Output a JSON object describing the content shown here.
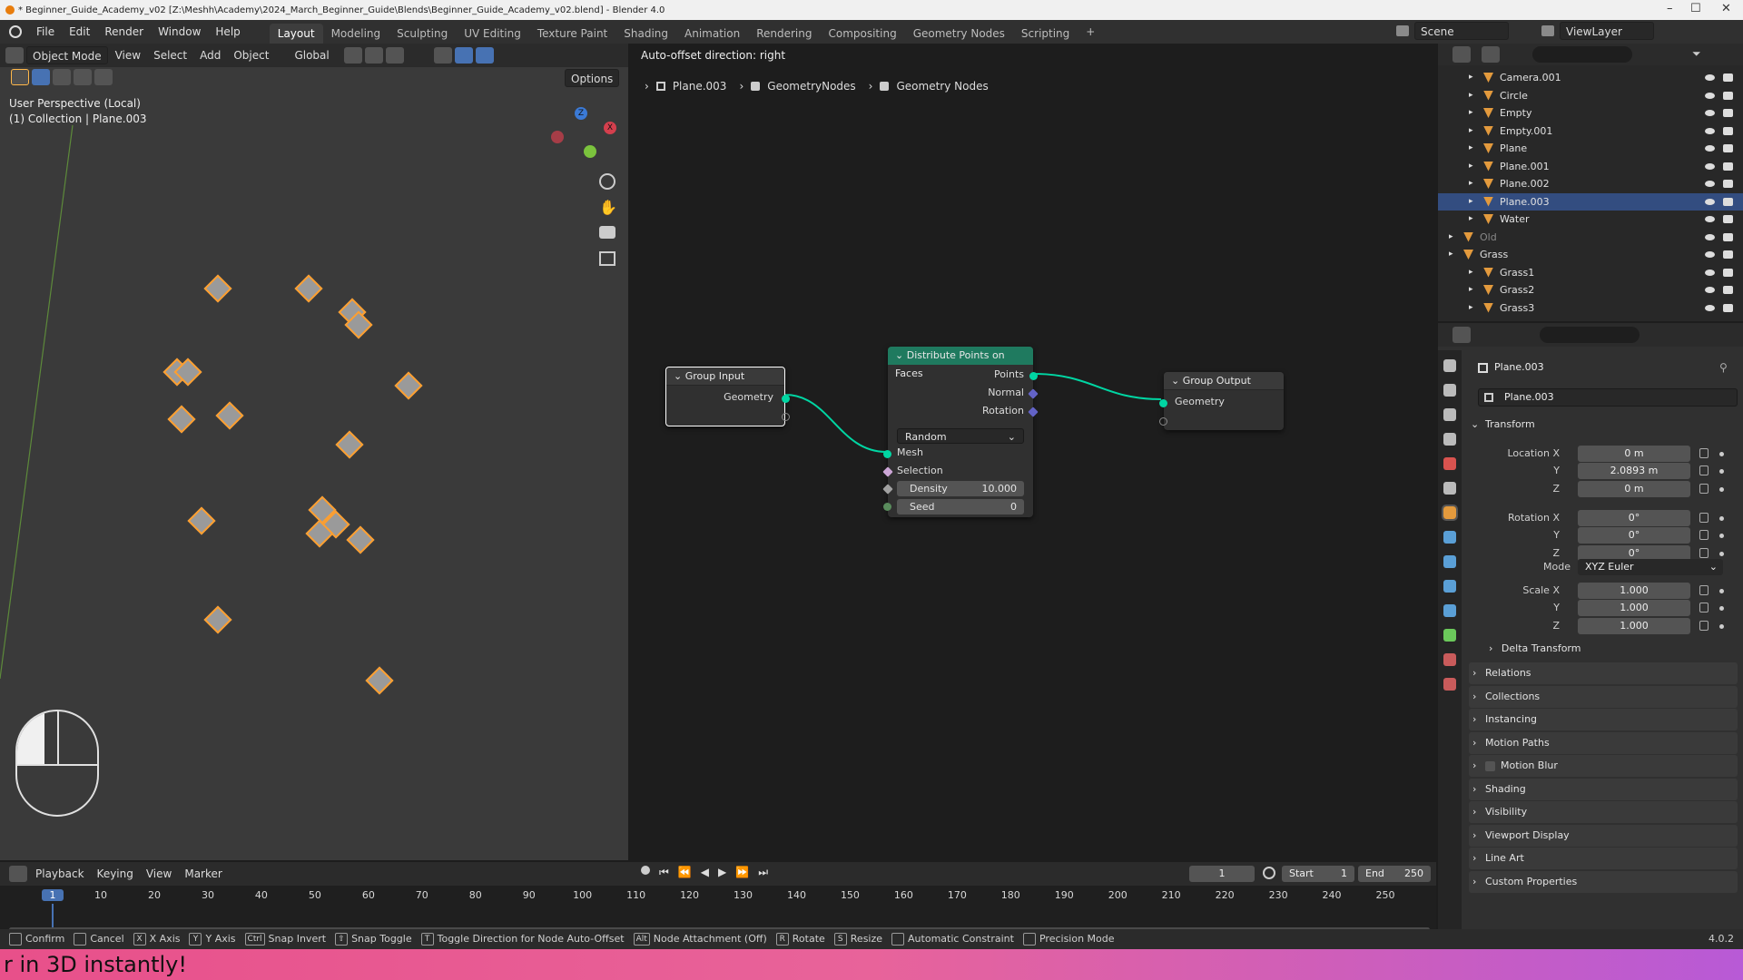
{
  "window": {
    "title": "* Beginner_Guide_Academy_v02 [Z:\\Meshh\\Academy\\2024_March_Beginner_Guide\\Blends\\Beginner_Guide_Academy_v02.blend] - Blender 4.0"
  },
  "menu": [
    "File",
    "Edit",
    "Render",
    "Window",
    "Help"
  ],
  "workspaces": [
    "Layout",
    "Modeling",
    "Sculpting",
    "UV Editing",
    "Texture Paint",
    "Shading",
    "Animation",
    "Rendering",
    "Compositing",
    "Geometry Nodes",
    "Scripting"
  ],
  "workspace_add": "+",
  "scene": {
    "name": "Scene",
    "view_layer": "ViewLayer"
  },
  "viewport": {
    "mode": "Object Mode",
    "menus": [
      "View",
      "Select",
      "Add",
      "Object"
    ],
    "transform": "Global",
    "options": "Options",
    "perspective": "User Perspective (Local)",
    "collection": "(1) Collection | Plane.003",
    "gizmo": {
      "z": "Z",
      "x": "X"
    }
  },
  "node_editor": {
    "status": "Auto-offset direction: right",
    "breadcrumb": [
      "Plane.003",
      "GeometryNodes",
      "Geometry Nodes"
    ],
    "group_input": {
      "title": "Group Input",
      "out": "Geometry"
    },
    "distribute": {
      "title": "Distribute Points on Faces",
      "outs": [
        "Points",
        "Normal",
        "Rotation"
      ],
      "mode": "Random",
      "ins": [
        "Mesh",
        "Selection"
      ],
      "density_label": "Density",
      "density": "10.000",
      "seed_label": "Seed",
      "seed": "0"
    },
    "group_output": {
      "title": "Group Output",
      "in": "Geometry"
    }
  },
  "outliner": {
    "items": [
      {
        "name": "Camera.001",
        "sel": false
      },
      {
        "name": "Circle",
        "sel": false
      },
      {
        "name": "Empty",
        "sel": false
      },
      {
        "name": "Empty.001",
        "sel": false
      },
      {
        "name": "Plane",
        "sel": false
      },
      {
        "name": "Plane.001",
        "sel": false
      },
      {
        "name": "Plane.002",
        "sel": false
      },
      {
        "name": "Plane.003",
        "sel": true
      },
      {
        "name": "Water",
        "sel": false
      },
      {
        "name": "Old",
        "sel": false
      },
      {
        "name": "Grass",
        "sel": false
      },
      {
        "name": "Grass1",
        "sel": false
      },
      {
        "name": "Grass2",
        "sel": false
      },
      {
        "name": "Grass3",
        "sel": false
      }
    ]
  },
  "properties": {
    "object": "Plane.003",
    "data": "Plane.003",
    "transform": "Transform",
    "location": {
      "label": "Location X",
      "x": "0 m",
      "y": "2.0893 m",
      "z": "0 m"
    },
    "rotation": {
      "label": "Rotation X",
      "x": "0°",
      "y": "0°",
      "z": "0°"
    },
    "mode_label": "Mode",
    "mode": "XYZ Euler",
    "scale": {
      "label": "Scale X",
      "x": "1.000",
      "y": "1.000",
      "z": "1.000"
    },
    "axis": {
      "y": "Y",
      "z": "Z"
    },
    "delta": "Delta Transform",
    "panels": [
      "Relations",
      "Collections",
      "Instancing",
      "Motion Paths",
      "Motion Blur",
      "Shading",
      "Visibility",
      "Viewport Display",
      "Line Art",
      "Custom Properties"
    ]
  },
  "timeline": {
    "menus": [
      "Playback",
      "Keying",
      "View",
      "Marker"
    ],
    "frame": "1",
    "start_label": "Start",
    "start": "1",
    "end_label": "End",
    "end": "250",
    "ticks": [
      "1",
      "10",
      "20",
      "30",
      "40",
      "50",
      "60",
      "70",
      "80",
      "90",
      "100",
      "110",
      "120",
      "130",
      "140",
      "150",
      "160",
      "170",
      "180",
      "190",
      "200",
      "210",
      "220",
      "230",
      "240",
      "250"
    ]
  },
  "statusbar": {
    "items": [
      {
        "key": "",
        "label": "Confirm"
      },
      {
        "key": "",
        "label": "Cancel"
      },
      {
        "key": "X",
        "label": "X Axis"
      },
      {
        "key": "Y",
        "label": "Y Axis"
      },
      {
        "key": "Ctrl",
        "label": "Snap Invert"
      },
      {
        "key": "⇧",
        "label": "Snap Toggle"
      },
      {
        "key": "T",
        "label": "Toggle Direction for Node Auto-Offset"
      },
      {
        "key": "Alt",
        "label": "Node Attachment (Off)"
      },
      {
        "key": "R",
        "label": "Rotate"
      },
      {
        "key": "S",
        "label": "Resize"
      },
      {
        "key": "",
        "label": "Automatic Constraint"
      },
      {
        "key": "",
        "label": "Precision Mode"
      }
    ],
    "version": "4.0.2"
  },
  "banner": "r in 3D instantly!",
  "colors": {
    "accent": "#4772b3",
    "geometry_socket": "#00d6a3",
    "distribute_header": "#1f7a5f"
  }
}
